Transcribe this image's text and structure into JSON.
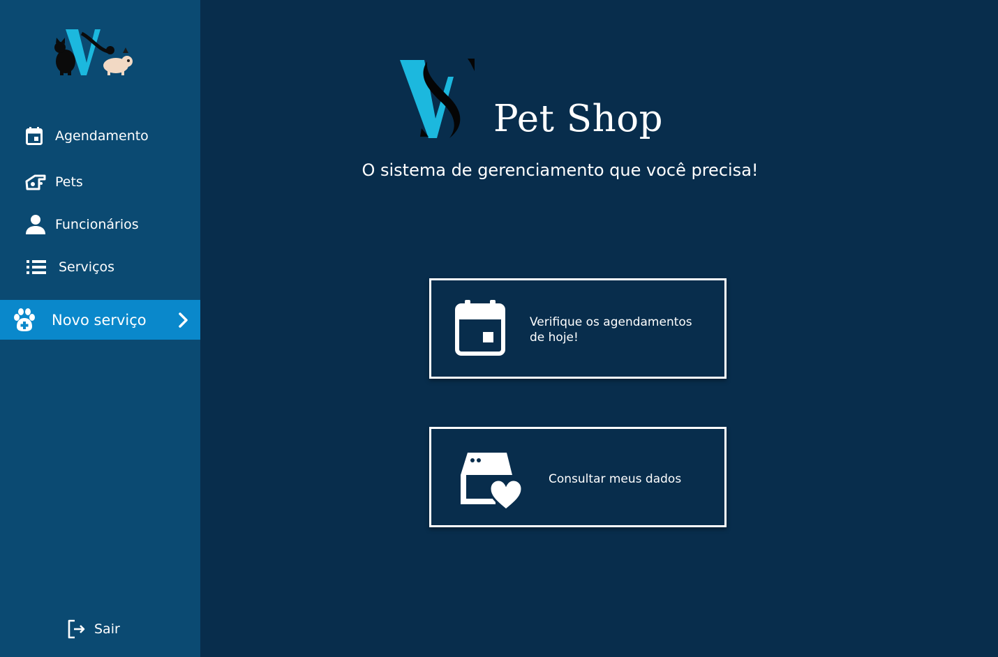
{
  "sidebar": {
    "logo_icon": "cats-dog-v-logo",
    "items": [
      {
        "label": "Agendamento",
        "icon": "calendar-icon"
      },
      {
        "label": "Pets",
        "icon": "pet-house-icon"
      },
      {
        "label": "Funcionários",
        "icon": "person-icon"
      },
      {
        "label": "Serviços",
        "icon": "list-icon"
      }
    ],
    "highlight": {
      "label": "Novo serviço",
      "icon": "paw-plus-icon",
      "chevron": "chevron-right-icon"
    },
    "logout": {
      "label": "Sair",
      "icon": "logout-icon"
    }
  },
  "brand": {
    "name": "Pet Shop",
    "tagline": "O sistema de gerenciamento que você precisa!"
  },
  "cards": [
    {
      "text": "Verifique os agendamentos de hoje!",
      "icon": "calendar-icon"
    },
    {
      "text": "Consultar meus dados",
      "icon": "pet-store-heart-icon"
    }
  ],
  "colors": {
    "background": "#082d4c",
    "sidebar": "#0b4a72",
    "highlight": "#0a88cb",
    "accent_cyan": "#1cb8de",
    "text": "#ffffff"
  }
}
